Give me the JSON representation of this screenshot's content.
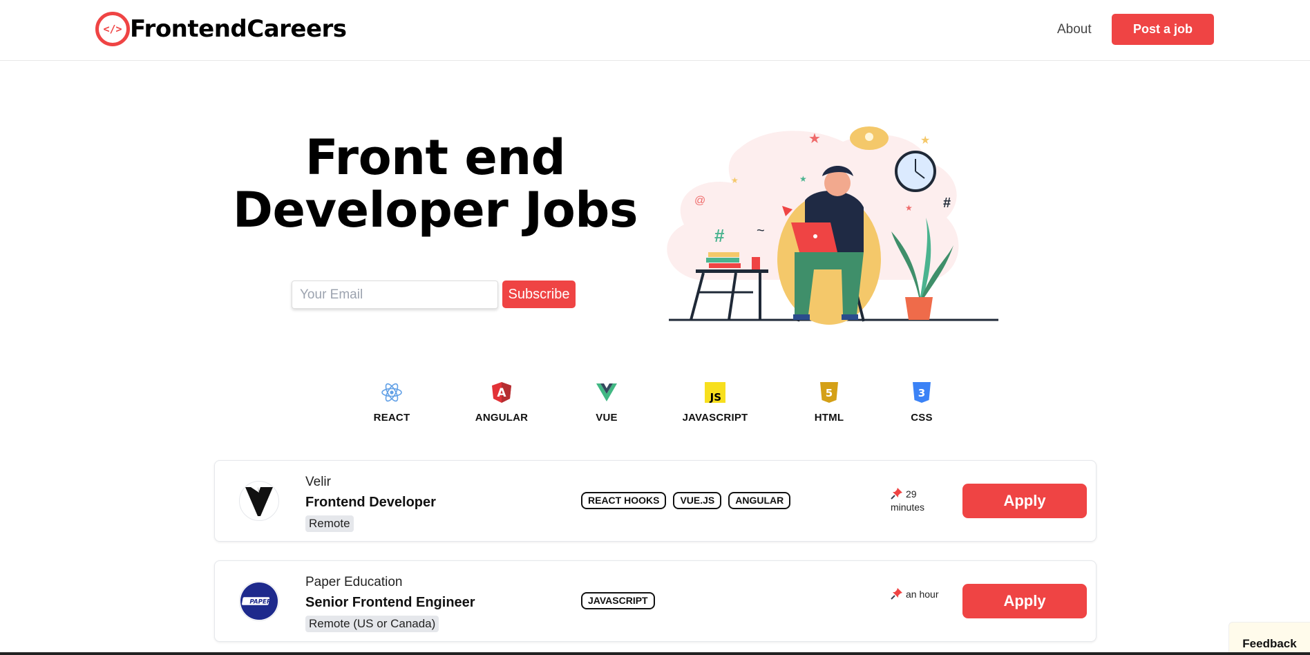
{
  "header": {
    "logo_mark": "</>",
    "logo_text": "FrontendCareers",
    "nav_about": "About",
    "post_job_label": "Post a job"
  },
  "hero": {
    "title_line1": "Front end",
    "title_line2": "Developer Jobs",
    "email_placeholder": "Your Email",
    "subscribe_label": "Subscribe"
  },
  "categories": [
    {
      "label": "REACT",
      "icon": "react-icon"
    },
    {
      "label": "ANGULAR",
      "icon": "angular-icon"
    },
    {
      "label": "VUE",
      "icon": "vue-icon"
    },
    {
      "label": "JAVASCRIPT",
      "icon": "javascript-icon"
    },
    {
      "label": "HTML",
      "icon": "html5-icon"
    },
    {
      "label": "CSS",
      "icon": "css3-icon"
    }
  ],
  "jobs": [
    {
      "company": "Velir",
      "title": "Frontend Developer",
      "location": "Remote",
      "tags": [
        "REACT HOOKS",
        "VUE.JS",
        "ANGULAR"
      ],
      "posted": "29 minutes",
      "apply_label": "Apply"
    },
    {
      "company": "Paper Education",
      "logo_text": "PAPER",
      "title": "Senior Frontend Engineer",
      "location": "Remote (US or Canada)",
      "tags": [
        "JAVASCRIPT"
      ],
      "posted": "an hour",
      "apply_label": "Apply"
    }
  ],
  "feedback_label": "Feedback",
  "colors": {
    "accent": "#ef4444",
    "tag_border": "#111111",
    "location_bg": "#e5e7eb"
  }
}
